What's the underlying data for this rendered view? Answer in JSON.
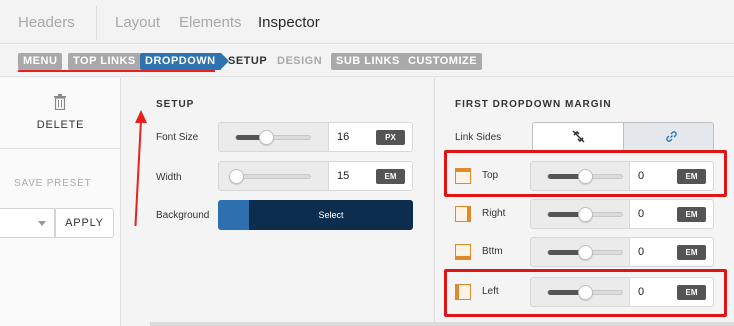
{
  "tabs": [
    "Headers",
    "Layout",
    "Elements",
    "Inspector"
  ],
  "breadcrumbs": [
    {
      "label": "MENU",
      "style": "pill"
    },
    {
      "label": "TOP LINKS",
      "style": "pill"
    },
    {
      "label": "DROPDOWN",
      "style": "active"
    },
    {
      "label": "SETUP",
      "style": "plain"
    },
    {
      "label": "DESIGN",
      "style": "muted"
    },
    {
      "label": "SUB LINKS",
      "style": "pill"
    },
    {
      "label": "CUSTOMIZE",
      "style": "pill"
    }
  ],
  "left_panel": {
    "delete_label": "DELETE",
    "save_preset_label": "SAVE PRESET",
    "apply_label": "APPLY"
  },
  "setup": {
    "title": "SETUP",
    "font_size": {
      "label": "Font Size",
      "value": "16",
      "unit": "PX",
      "slider_fraction": 0.4
    },
    "width": {
      "label": "Width",
      "value": "15",
      "unit": "EM",
      "slider_fraction": 0.0
    },
    "background": {
      "label": "Background",
      "button": "Select",
      "swatch_color": "#2e6fb0",
      "button_color": "#0d2d4e"
    }
  },
  "margin": {
    "title": "FIRST DROPDOWN MARGIN",
    "link_sides_label": "Link Sides",
    "sides": [
      {
        "label": "Top",
        "value": "0",
        "unit": "EM",
        "slider_fraction": 0.5
      },
      {
        "label": "Right",
        "value": "0",
        "unit": "EM",
        "slider_fraction": 0.5
      },
      {
        "label": "Bttm",
        "value": "0",
        "unit": "EM",
        "slider_fraction": 0.5
      },
      {
        "label": "Left",
        "value": "0",
        "unit": "EM",
        "slider_fraction": 0.5
      }
    ]
  },
  "colors": {
    "accent": "#2f72b0",
    "annotation": "#e01414",
    "icon_orange": "#e08a2c"
  }
}
